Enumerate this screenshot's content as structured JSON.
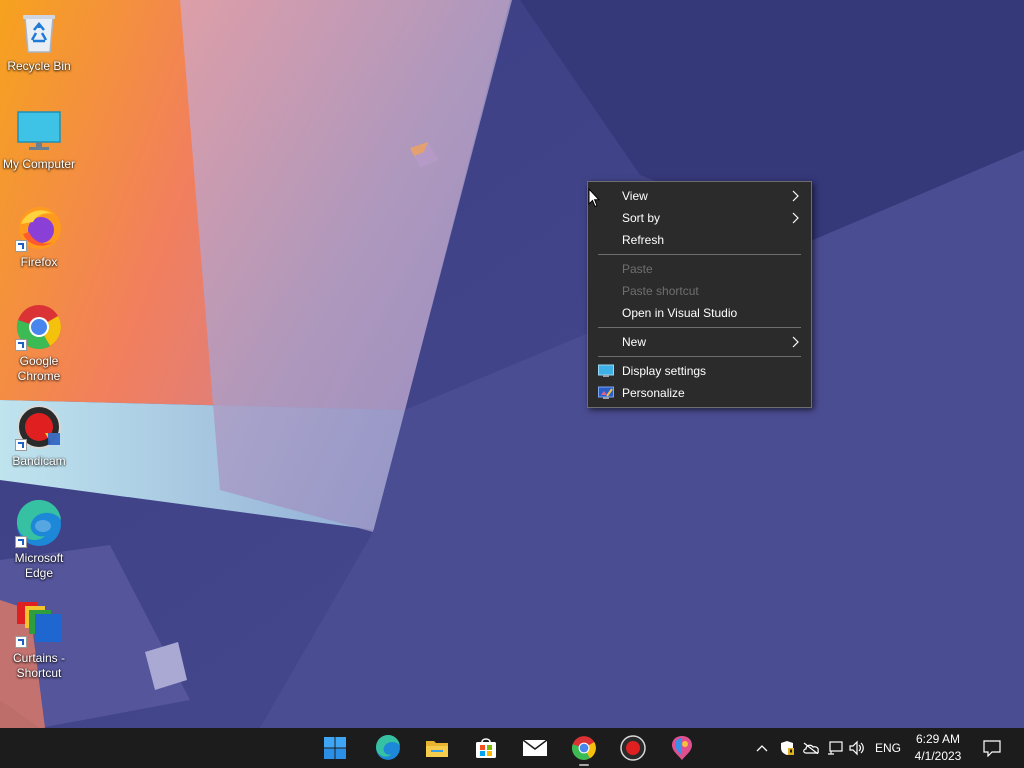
{
  "desktop": {
    "icons": [
      {
        "label": "Recycle Bin",
        "icon": "recycle-bin-icon"
      },
      {
        "label": "My Computer",
        "icon": "monitor-icon"
      },
      {
        "label": "Firefox",
        "icon": "firefox-icon"
      },
      {
        "label": "Google Chrome",
        "icon": "chrome-icon"
      },
      {
        "label": "Bandicam",
        "icon": "bandicam-icon"
      },
      {
        "label": "Microsoft Edge",
        "icon": "edge-icon"
      },
      {
        "label": "Curtains - Shortcut",
        "icon": "curtains-icon"
      }
    ]
  },
  "context_menu": {
    "items": [
      {
        "label": "View",
        "submenu": true,
        "enabled": true
      },
      {
        "label": "Sort by",
        "submenu": true,
        "enabled": true
      },
      {
        "label": "Refresh",
        "submenu": false,
        "enabled": true
      },
      {
        "label": "Paste",
        "submenu": false,
        "enabled": false
      },
      {
        "label": "Paste shortcut",
        "submenu": false,
        "enabled": false
      },
      {
        "label": "Open in Visual Studio",
        "submenu": false,
        "enabled": true
      },
      {
        "label": "New",
        "submenu": true,
        "enabled": true
      },
      {
        "label": "Display settings",
        "submenu": false,
        "enabled": true,
        "icon": "display-icon"
      },
      {
        "label": "Personalize",
        "submenu": false,
        "enabled": true,
        "icon": "personalize-icon"
      }
    ]
  },
  "taskbar": {
    "apps": [
      {
        "icon": "windows-start-icon"
      },
      {
        "icon": "edge-icon"
      },
      {
        "icon": "file-explorer-icon"
      },
      {
        "icon": "microsoft-store-icon"
      },
      {
        "icon": "mail-icon"
      },
      {
        "icon": "chrome-icon",
        "running": true
      },
      {
        "icon": "bandicam-icon"
      },
      {
        "icon": "paint-icon"
      }
    ],
    "tray": {
      "icons": [
        "chevron-up-icon",
        "security-icon",
        "onedrive-icon",
        "network-icon",
        "volume-icon"
      ],
      "language": "ENG",
      "time": "6:29 AM",
      "date": "4/1/2023"
    }
  },
  "colors": {
    "taskbar_bg": "#1c1c1c",
    "menu_bg": "#2b2b2b",
    "menu_border": "#6e6e6e",
    "disabled_text": "#6f6f6f"
  }
}
